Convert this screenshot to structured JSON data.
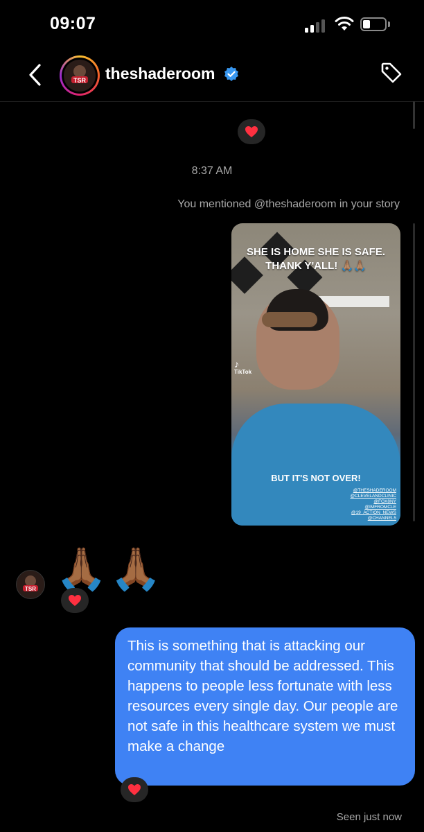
{
  "status_bar": {
    "time": "09:07"
  },
  "header": {
    "username": "theshaderoom",
    "verified": true,
    "back_icon": "chevron-left-icon",
    "action_icon": "tag-icon"
  },
  "thread": {
    "reaction_heart": "❤️",
    "timestamp": "8:37 AM",
    "mention_note": "You mentioned @theshaderoom in your story",
    "story": {
      "caption_top_line1": "SHE IS HOME SHE IS SAFE.",
      "caption_top_line2": "THANK Y'ALL! 🙏🏽🙏🏽",
      "caption_bottom": "BUT IT'S NOT OVER!",
      "tiktok_label": "TikTok",
      "handles": [
        "@THESHADEROOM",
        "@CLEVELANDCLINIC",
        "@FOX8NY",
        "@IMFROMCLE",
        "@19_ACTION_NEWS",
        "@CHANNEL5"
      ]
    },
    "received_emoji": "🙏🏾🙏🏾",
    "sent_message": "This is something that is attacking our community that should be addressed. This happens to people less fortunate with less resources every single day. Our people are not safe in this healthcare system we must make a change",
    "seen_status": "Seen just now"
  },
  "colors": {
    "bubble": "#3f82f4",
    "verified": "#3897f0",
    "heart": "#ff3040"
  }
}
